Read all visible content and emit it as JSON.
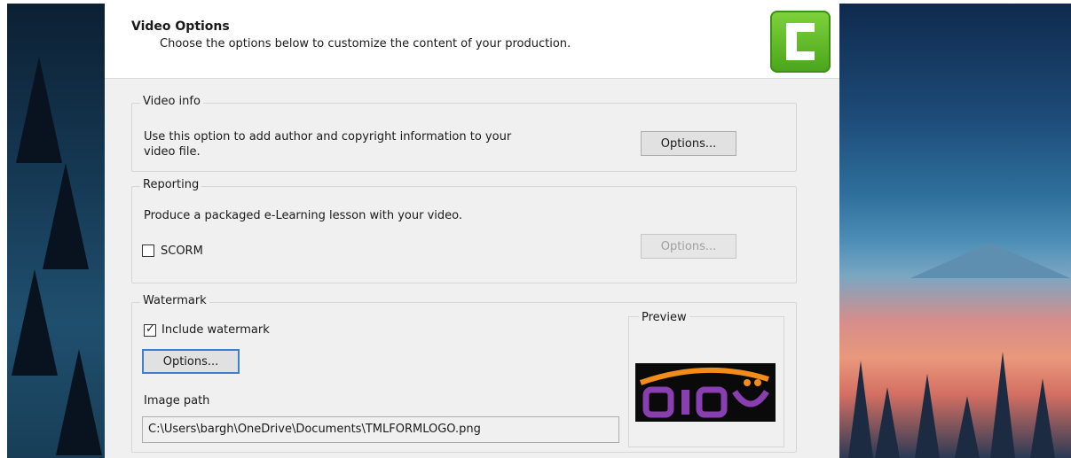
{
  "header": {
    "title": "Video Options",
    "subtitle": "Choose the options below to customize the content of your production."
  },
  "logo": {
    "icon": "camtasia-logo-icon",
    "color": "#5db52a"
  },
  "video_info": {
    "legend": "Video info",
    "description_line1": "Use this option to add author and copyright information to your",
    "description_line2": "video file.",
    "options_label": "Options..."
  },
  "reporting": {
    "legend": "Reporting",
    "description": "Produce a packaged e-Learning lesson with your video.",
    "scorm_label": "SCORM",
    "scorm_checked": false,
    "options_label": "Options..."
  },
  "watermark": {
    "legend": "Watermark",
    "include_label": "Include watermark",
    "include_checked": true,
    "options_label": "Options...",
    "image_path_label": "Image path",
    "image_path_value": "C:\\Users\\bargh\\OneDrive\\Documents\\TMLFORMLOGO.png",
    "preview_label": "Preview"
  },
  "colors": {
    "accent": "#3c7fd0",
    "logo_green": "#5db52a",
    "preview_orange": "#f28c1b",
    "preview_purple": "#8a3fb0"
  }
}
